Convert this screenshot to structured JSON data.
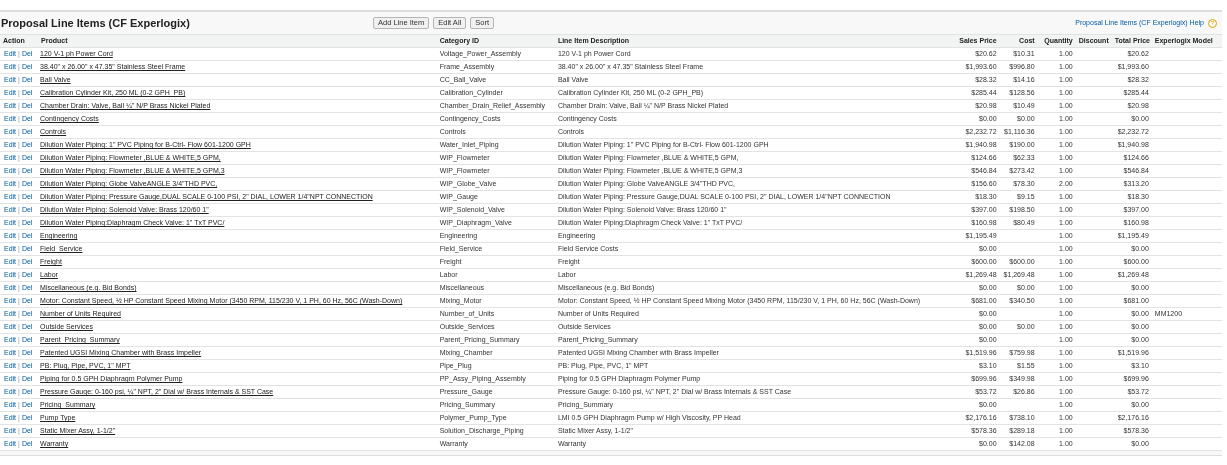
{
  "section": {
    "title": "Proposal Line Items (CF Experlogix)",
    "buttons": [
      "Add Line Item",
      "Edit All",
      "Sort"
    ],
    "help_link": "Proposal Line Items (CF Experlogix) Help",
    "help_icon": "?"
  },
  "table": {
    "columns": [
      "Action",
      "Product",
      "Category ID",
      "Line Item Description",
      "Sales Price",
      "Cost",
      "Quantity",
      "Discount",
      "Total Price",
      "Experlogix Model"
    ],
    "rows": [
      {
        "edit": "Edit",
        "sep": "|",
        "del": "Del",
        "product": "120 V-1 ph Power Cord",
        "category": "Voltage_Power_Assembly",
        "description": "120 V-1 ph Power Cord",
        "sales_price": "$20.62",
        "cost": "$10.31",
        "quantity": "1.00",
        "total_price": "$20.62"
      },
      {
        "edit": "Edit",
        "sep": "|",
        "del": "Del",
        "product": "38.40\" x 26.00\" x 47.35\" Stainless Steel Frame",
        "category": "Frame_Assembly",
        "description": "38.40\" x 26.00\" x 47.35\" Stainless Steel Frame",
        "sales_price": "$1,993.60",
        "cost": "$996.80",
        "quantity": "1.00",
        "total_price": "$1,993.60"
      },
      {
        "edit": "Edit",
        "sep": "|",
        "del": "Del",
        "product": "Ball Valve",
        "category": "CC_Ball_Valve",
        "description": "Ball Valve",
        "sales_price": "$28.32",
        "cost": "$14.16",
        "quantity": "1.00",
        "total_price": "$28.32"
      },
      {
        "edit": "Edit",
        "sep": "|",
        "del": "Del",
        "product": "Calibration Cylinder Kit, 250 ML (0-2 GPH_PB)",
        "category": "Calibration_Cylinder",
        "description": "Calibration Cylinder Kit, 250 ML (0-2 GPH_PB)",
        "sales_price": "$285.44",
        "cost": "$128.56",
        "quantity": "1.00",
        "total_price": "$285.44"
      },
      {
        "edit": "Edit",
        "sep": "|",
        "del": "Del",
        "product": "Chamber Drain: Valve, Ball ¼\" N/P Brass Nickel Plated",
        "category": "Chamber_Drain_Relief_Assembly",
        "description": "Chamber Drain: Valve, Ball ¼\" N/P Brass Nickel Plated",
        "sales_price": "$20.98",
        "cost": "$10.49",
        "quantity": "1.00",
        "total_price": "$20.98"
      },
      {
        "edit": "Edit",
        "sep": "|",
        "del": "Del",
        "product": "Contingency Costs",
        "category": "Contingency_Costs",
        "description": "Contingency Costs",
        "sales_price": "$0.00",
        "cost": "$0.00",
        "quantity": "1.00",
        "total_price": "$0.00"
      },
      {
        "edit": "Edit",
        "sep": "|",
        "del": "Del",
        "product": "Controls",
        "category": "Controls",
        "description": "Controls",
        "sales_price": "$2,232.72",
        "cost": "$1,116.36",
        "quantity": "1.00",
        "total_price": "$2,232.72"
      },
      {
        "edit": "Edit",
        "sep": "|",
        "del": "Del",
        "product": "Dilution Water Piping: 1\" PVC Piping for B-Ctrl- Flow 601-1200 GPH",
        "category": "Water_Inlet_Piping",
        "description": "Dilution Water Piping: 1\" PVC Piping for B-Ctrl- Flow 601-1200 GPH",
        "sales_price": "$1,940.98",
        "cost": "$190.00",
        "quantity": "1.00",
        "total_price": "$1,940.98"
      },
      {
        "edit": "Edit",
        "sep": "|",
        "del": "Del",
        "product": "Dilution Water Piping: Flowmeter ,BLUE & WHITE,5 GPM,",
        "category": "WIP_Flowmeter",
        "description": "Dilution Water Piping: Flowmeter ,BLUE & WHITE,5 GPM,",
        "sales_price": "$124.66",
        "cost": "$62.33",
        "quantity": "1.00",
        "total_price": "$124.66"
      },
      {
        "edit": "Edit",
        "sep": "|",
        "del": "Del",
        "product": "Dilution Water Piping: Flowmeter ,BLUE & WHITE,5 GPM,3",
        "category": "WIP_Flowmeter",
        "description": "Dilution Water Piping: Flowmeter ,BLUE & WHITE,5 GPM,3",
        "sales_price": "$546.84",
        "cost": "$273.42",
        "quantity": "1.00",
        "total_price": "$546.84"
      },
      {
        "edit": "Edit",
        "sep": "|",
        "del": "Del",
        "product": "Dilution Water Piping: Globe ValveANGLE 3/4\"THD PVC,",
        "category": "WIP_Globe_Valve",
        "description": "Dilution Water Piping: Globe ValveANGLE 3/4\"THD PVC,",
        "sales_price": "$156.60",
        "cost": "$78.30",
        "quantity": "2.00",
        "total_price": "$313.20"
      },
      {
        "edit": "Edit",
        "sep": "|",
        "del": "Del",
        "product": "Dilution Water Piping: Pressure Gauge,DUAL SCALE 0-100 PSI, 2\" DIAL, LOWER 1/4\"NPT CONNECTION",
        "category": "WIP_Gauge",
        "description": "Dilution Water Piping: Pressure Gauge,DUAL SCALE 0-100 PSI, 2\" DIAL, LOWER 1/4\"NPT CONNECTION",
        "sales_price": "$18.30",
        "cost": "$9.15",
        "quantity": "1.00",
        "total_price": "$18.30"
      },
      {
        "edit": "Edit",
        "sep": "|",
        "del": "Del",
        "product": "Dilution Water Piping: Solenoid Valve: Brass 120/60 1\"",
        "category": "WIP_Solenoid_Valve",
        "description": "Dilution Water Piping: Solenoid Valve: Brass 120/60 1\"",
        "sales_price": "$397.00",
        "cost": "$198.50",
        "quantity": "1.00",
        "total_price": "$397.00"
      },
      {
        "edit": "Edit",
        "sep": "|",
        "del": "Del",
        "product": "Dilution Water Piping:Diaphragm Check Valve: 1\" TxT PVC/",
        "category": "WIP_Diaphragm_Valve",
        "description": "Dilution Water Piping:Diaphragm Check Valve: 1\" TxT PVC/",
        "sales_price": "$160.98",
        "cost": "$80.49",
        "quantity": "1.00",
        "total_price": "$160.98"
      },
      {
        "edit": "Edit",
        "sep": "|",
        "del": "Del",
        "product": "Engineering",
        "category": "Engineering",
        "description": "Engineering",
        "sales_price": "$1,195.49",
        "quantity": "1.00",
        "total_price": "$1,195.49"
      },
      {
        "edit": "Edit",
        "sep": "|",
        "del": "Del",
        "product": "Field_Service",
        "category": "Field_Service",
        "description": "Field Service Costs",
        "sales_price": "$0.00",
        "quantity": "1.00",
        "total_price": "$0.00"
      },
      {
        "edit": "Edit",
        "sep": "|",
        "del": "Del",
        "product": "Freight",
        "category": "Freight",
        "description": "Freight",
        "sales_price": "$600.00",
        "cost": "$600.00",
        "quantity": "1.00",
        "total_price": "$600.00"
      },
      {
        "edit": "Edit",
        "sep": "|",
        "del": "Del",
        "product": "Labor",
        "category": "Labor",
        "description": "Labor",
        "sales_price": "$1,269.48",
        "cost": "$1,269.48",
        "quantity": "1.00",
        "total_price": "$1,269.48"
      },
      {
        "edit": "Edit",
        "sep": "|",
        "del": "Del",
        "product": "Miscellaneous (e.g. Bid Bonds)",
        "category": "Miscellaneous",
        "description": "Miscellaneous (e.g. Bid Bonds)",
        "sales_price": "$0.00",
        "cost": "$0.00",
        "quantity": "1.00",
        "total_price": "$0.00"
      },
      {
        "edit": "Edit",
        "sep": "|",
        "del": "Del",
        "product": "Motor: Constant Speed, ½ HP Constant Speed Mixing Motor (3450 RPM, 115/230 V, 1 PH, 60 Hz, 56C (Wash-Down)",
        "category": "Mixing_Motor",
        "description": "Motor: Constant Speed, ½ HP Constant Speed Mixing Motor (3450 RPM, 115/230 V, 1 PH, 60 Hz, 56C (Wash-Down)",
        "sales_price": "$681.00",
        "cost": "$340.50",
        "quantity": "1.00",
        "total_price": "$681.00"
      },
      {
        "edit": "Edit",
        "sep": "|",
        "del": "Del",
        "product": "Number of Units Required",
        "category": "Number_of_Units",
        "description": "Number of Units Required",
        "sales_price": "$0.00",
        "quantity": "1.00",
        "total_price": "$0.00",
        "model": "MM1200"
      },
      {
        "edit": "Edit",
        "sep": "|",
        "del": "Del",
        "product": "Outside Services",
        "category": "Outside_Services",
        "description": "Outside Services",
        "sales_price": "$0.00",
        "cost": "$0.00",
        "quantity": "1.00",
        "total_price": "$0.00"
      },
      {
        "edit": "Edit",
        "sep": "|",
        "del": "Del",
        "product": "Parent_Pricing_Summary",
        "category": "Parent_Pricing_Summary",
        "description": "Parent_Pricing_Summary",
        "sales_price": "$0.00",
        "quantity": "1.00",
        "total_price": "$0.00"
      },
      {
        "edit": "Edit",
        "sep": "|",
        "del": "Del",
        "product": "Patented UGSI Mixing Chamber with Brass Impeller",
        "category": "Mixing_Chamber",
        "description": "Patented UGSI Mixing Chamber with Brass Impeller",
        "sales_price": "$1,519.96",
        "cost": "$759.98",
        "quantity": "1.00",
        "total_price": "$1,519.96"
      },
      {
        "edit": "Edit",
        "sep": "|",
        "del": "Del",
        "product": "PB: Plug, Pipe, PVC, 1\" MPT",
        "category": "Pipe_Plug",
        "description": "PB: Plug, Pipe, PVC, 1\" MPT",
        "sales_price": "$3.10",
        "cost": "$1.55",
        "quantity": "1.00",
        "total_price": "$3.10"
      },
      {
        "edit": "Edit",
        "sep": "|",
        "del": "Del",
        "product": "Piping for 0.5 GPH Diaphragm Polymer Pump",
        "category": "PP_Assy_Piping_Assembly",
        "description": "Piping for 0.5 GPH Diaphragm Polymer Pump",
        "sales_price": "$699.96",
        "cost": "$349.98",
        "quantity": "1.00",
        "total_price": "$699.96"
      },
      {
        "edit": "Edit",
        "sep": "|",
        "del": "Del",
        "product": "Pressure Gauge: 0-160 psi, ¼\" NPT, 2\" Dial w/ Brass Internals & SST Case",
        "category": "Pressure_Gauge",
        "description": "Pressure Gauge: 0-160 psi, ¼\" NPT, 2\" Dial w/ Brass Internals & SST Case",
        "sales_price": "$53.72",
        "cost": "$26.86",
        "quantity": "1.00",
        "total_price": "$53.72"
      },
      {
        "edit": "Edit",
        "sep": "|",
        "del": "Del",
        "product": "Pricing_Summary",
        "category": "Pricing_Summary",
        "description": "Pricing_Summary",
        "sales_price": "$0.00",
        "quantity": "1.00",
        "total_price": "$0.00"
      },
      {
        "edit": "Edit",
        "sep": "|",
        "del": "Del",
        "product": "Pump Type",
        "category": "Polymer_Pump_Type",
        "description": "LMI 0.5 GPH Diaphragm Pump w/ High Viscosity, PP Head",
        "sales_price": "$2,176.16",
        "cost": "$738.10",
        "quantity": "1.00",
        "total_price": "$2,176.16"
      },
      {
        "edit": "Edit",
        "sep": "|",
        "del": "Del",
        "product": "Static Mixer Assy, 1-1/2\"",
        "category": "Solution_Discharge_Piping",
        "description": "Static Mixer Assy, 1-1/2\"",
        "sales_price": "$578.36",
        "cost": "$289.18",
        "quantity": "1.00",
        "total_price": "$578.36"
      },
      {
        "edit": "Edit",
        "sep": "|",
        "del": "Del",
        "product": "Warranty",
        "category": "Warranty",
        "description": "Warranty",
        "sales_price": "$0.00",
        "cost": "$142.08",
        "quantity": "1.00",
        "total_price": "$0.00"
      }
    ]
  }
}
